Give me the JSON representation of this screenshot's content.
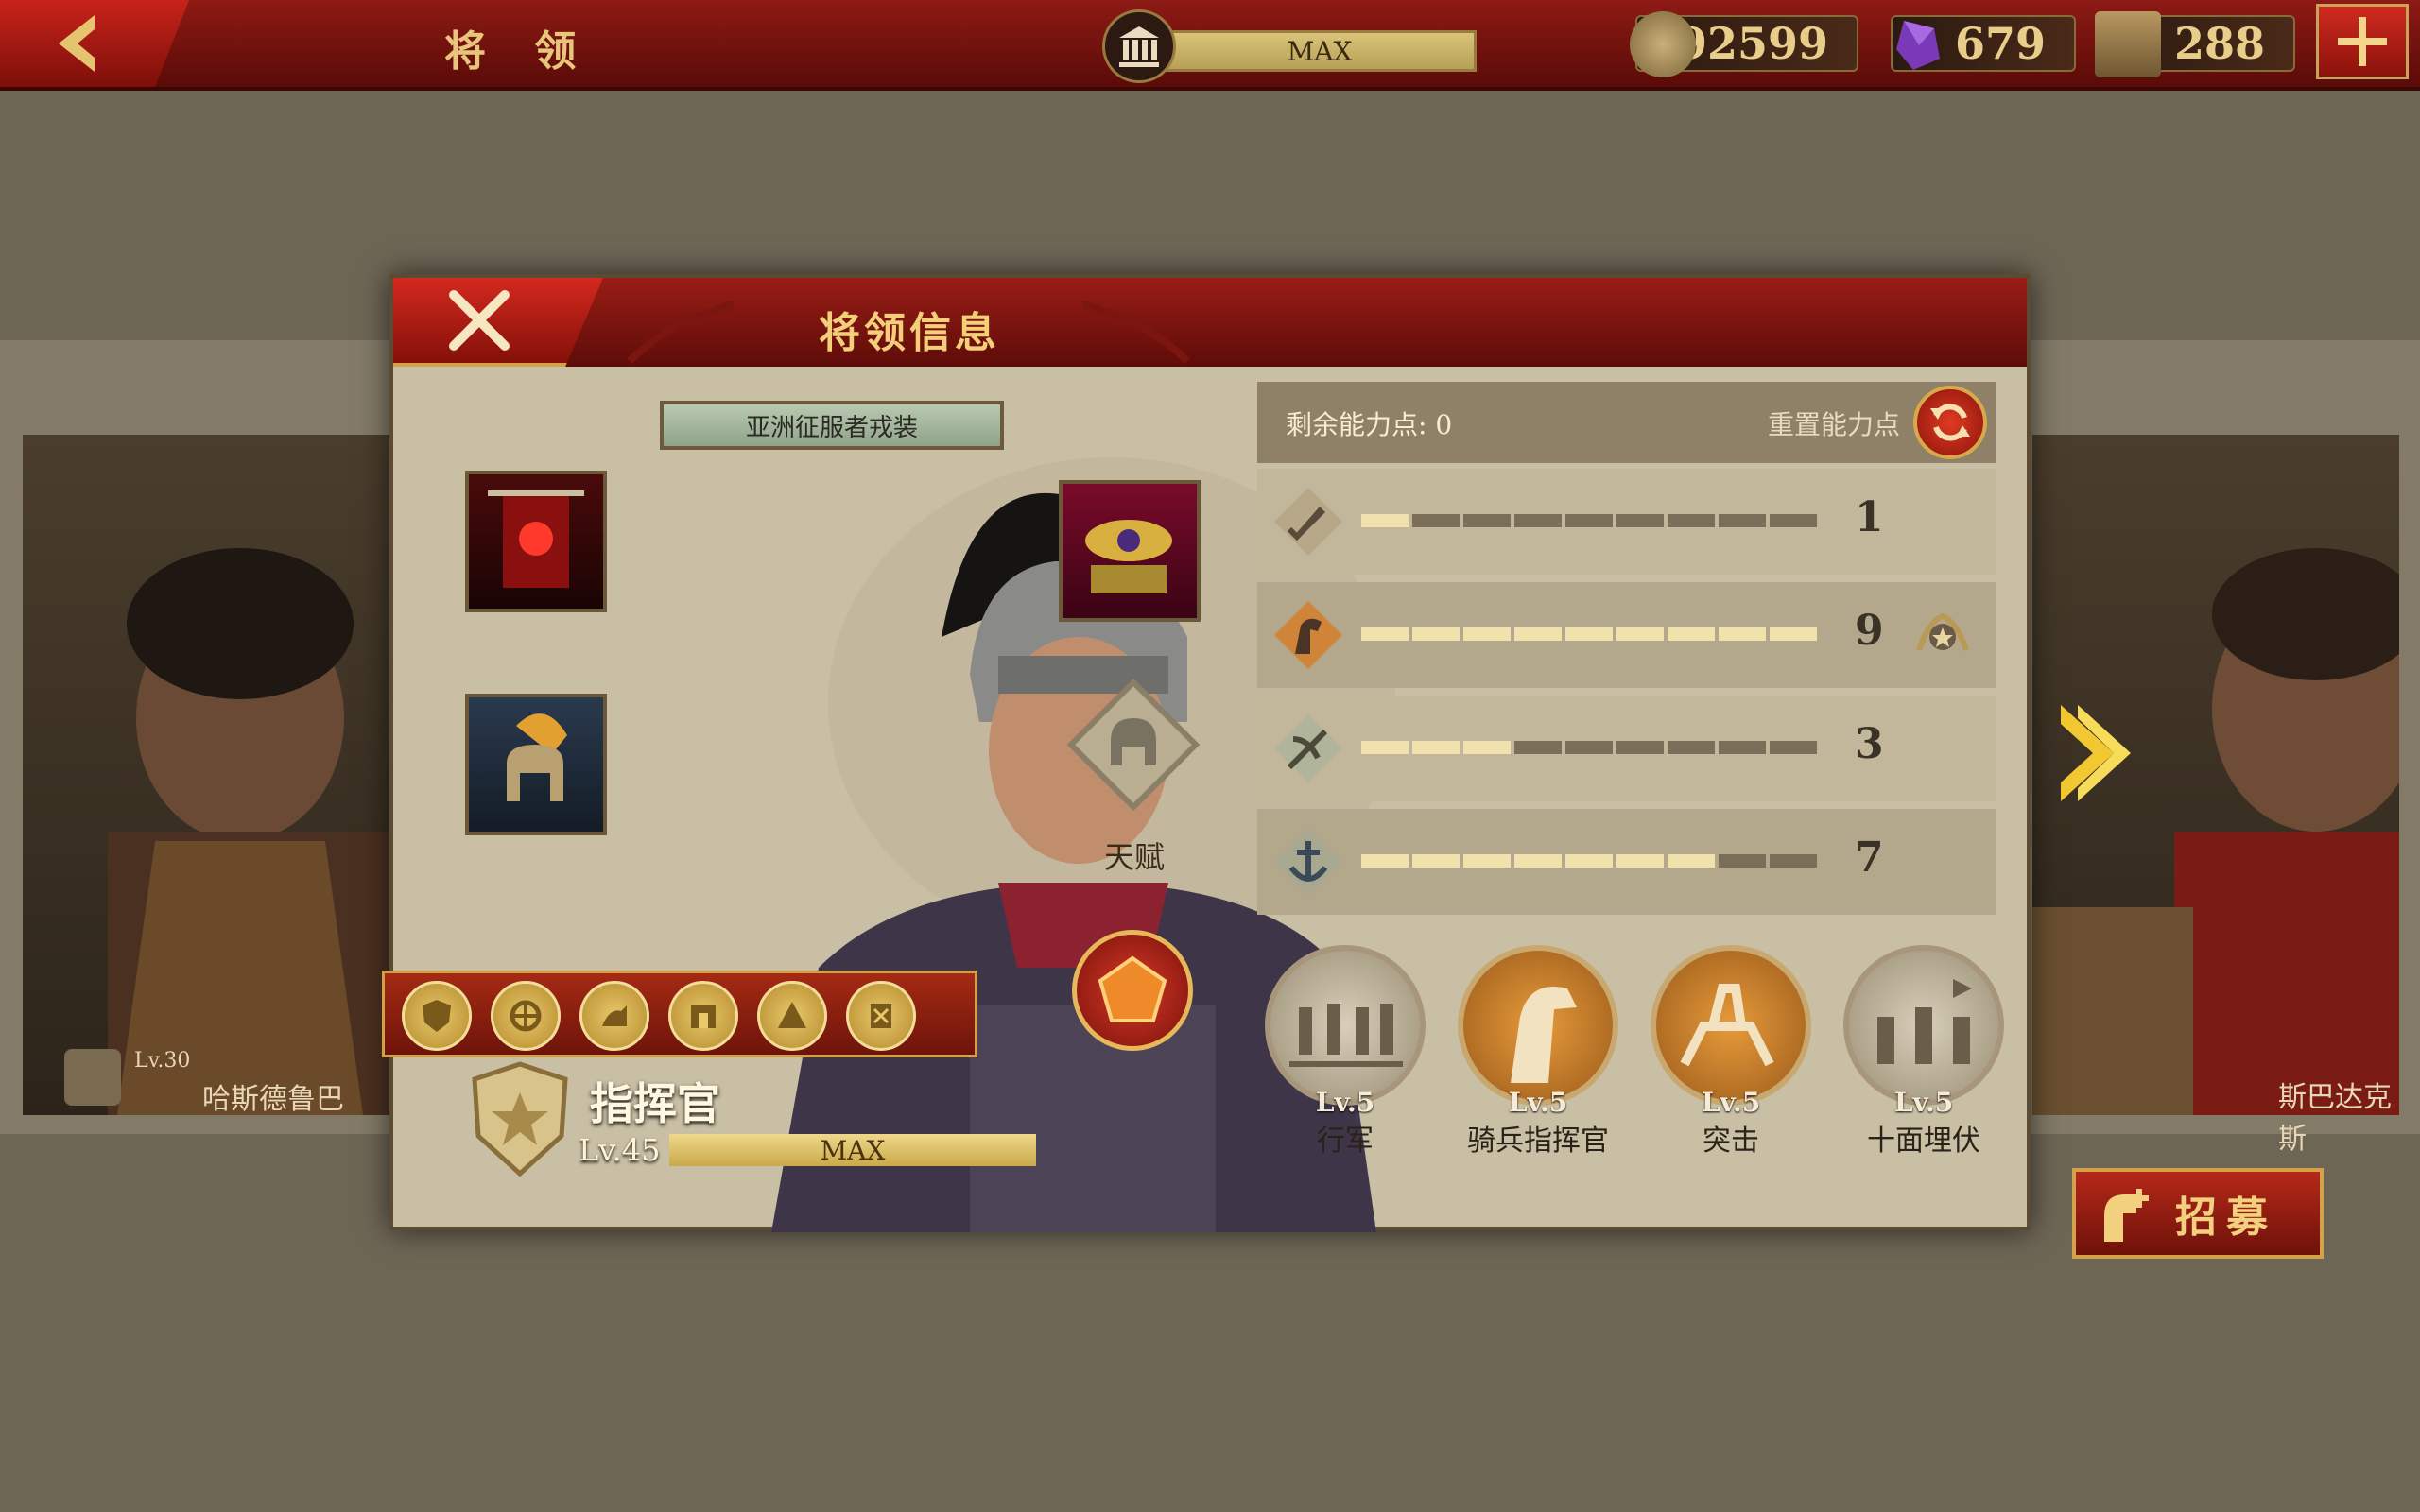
{
  "topbar": {
    "title": "将 领",
    "government_level": "MAX",
    "coins": "992599",
    "gems": "679",
    "tokens": "288"
  },
  "background": {
    "left_general_name": "哈斯德鲁巴",
    "left_general_level": "Lv.30",
    "right_general_name": "斯巴达克斯"
  },
  "modal": {
    "title": "将领信息",
    "outfit": "亚洲征服者戎装",
    "talent_label": "天赋",
    "rank_title": "指挥官",
    "level": "Lv.45",
    "xp_label": "MAX"
  },
  "stats": {
    "remaining_points_label": "剩余能力点: 0",
    "reset_label": "重置能力点",
    "rows": [
      {
        "icon": "sword-icon",
        "value": 1,
        "max": 9
      },
      {
        "icon": "horse-icon",
        "value": 9,
        "max": 9
      },
      {
        "icon": "crossbow-icon",
        "value": 3,
        "max": 9
      },
      {
        "icon": "anchor-icon",
        "value": 7,
        "max": 9
      }
    ]
  },
  "skills": [
    {
      "level": "Lv.5",
      "name": "行军"
    },
    {
      "level": "Lv.5",
      "name": "骑兵指挥官"
    },
    {
      "level": "Lv.5",
      "name": "突击"
    },
    {
      "level": "Lv.5",
      "name": "十面埋伏"
    }
  ],
  "recruit_label": "招募",
  "colors": {
    "accent_red": "#8e1a14",
    "gold": "#e7c57a",
    "bar_filled": "#f1e2ad",
    "bar_empty": "#7a6e58"
  }
}
